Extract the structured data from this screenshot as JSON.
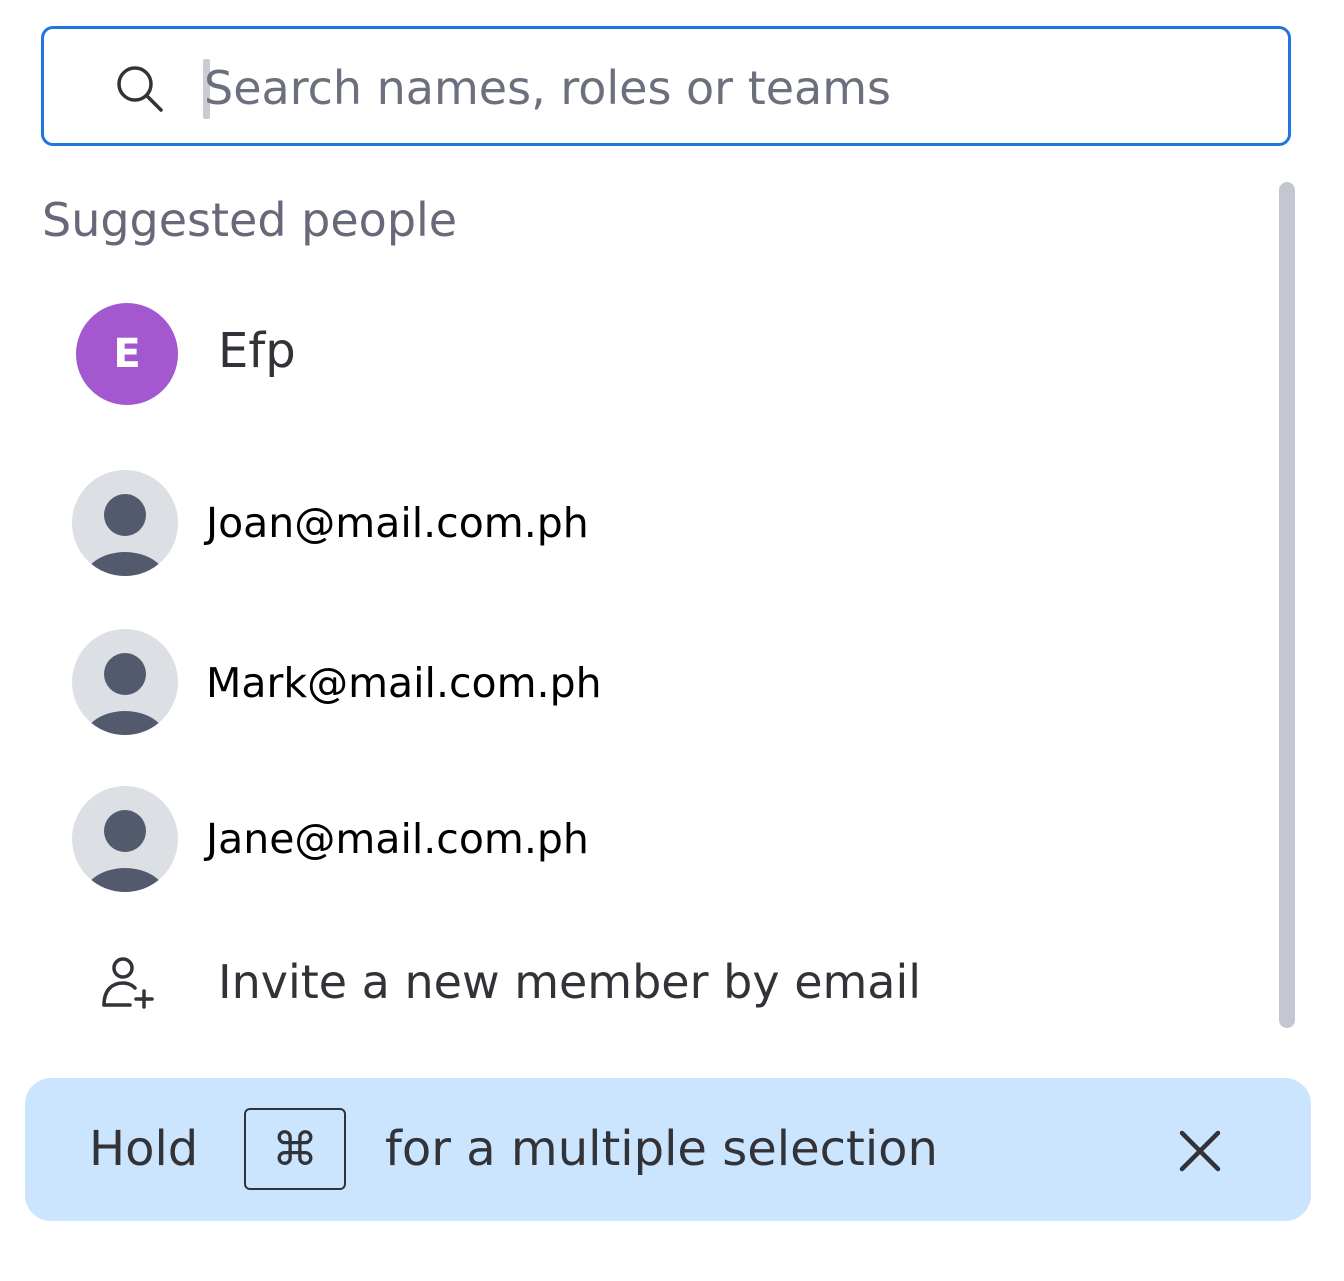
{
  "search": {
    "placeholder": "Search names, roles or teams",
    "value": ""
  },
  "section": {
    "title": "Suggested people"
  },
  "people": [
    {
      "initial": "E",
      "name": "Efp",
      "avatar": "initial",
      "avatar_color": "#a358d0"
    },
    {
      "name": "Joan@mail.com.ph",
      "avatar": "person-icon"
    },
    {
      "name": "Mark@mail.com.ph",
      "avatar": "person-icon"
    },
    {
      "name": "Jane@mail.com.ph",
      "avatar": "person-icon"
    }
  ],
  "invite": {
    "label": "Invite a new member by email",
    "icon": "add-person-icon"
  },
  "banner": {
    "hold_label": "Hold",
    "key_glyph": "⌘",
    "text": "for a multiple selection",
    "close_icon": "close-icon",
    "background": "#cce5ff"
  },
  "colors": {
    "focus_border": "#1f76e0",
    "text_primary": "#323338",
    "text_secondary": "#676879",
    "avatar_placeholder_bg": "#dcdfe4",
    "avatar_placeholder_fg": "#535a6d"
  }
}
